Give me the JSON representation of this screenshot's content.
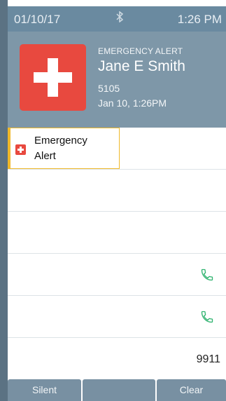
{
  "status_bar": {
    "date": "01/10/17",
    "bluetooth_symbol": "∦",
    "time": "1:26 PM"
  },
  "alert_header": {
    "type": "EMERGENCY ALERT",
    "name": "Jane E Smith",
    "extension": "5105",
    "datetime": "Jan 10, 1:26PM",
    "icon": "red-cross-icon"
  },
  "list": {
    "selected_item": {
      "label_line1": "Emergency",
      "label_line2": "Alert",
      "icon": "red-cross-icon"
    },
    "rows": [
      {
        "icon": "",
        "number": ""
      },
      {
        "icon": "",
        "number": ""
      },
      {
        "icon": "",
        "number": ""
      },
      {
        "icon": "phone-icon",
        "number": ""
      },
      {
        "icon": "phone-icon",
        "number": ""
      },
      {
        "icon": "",
        "number": "9911"
      }
    ]
  },
  "softkeys": {
    "left": "Silent",
    "middle": "",
    "right": "Clear"
  },
  "colors": {
    "status_bar": "#6a8aa0",
    "header": "#7e97a8",
    "alert_red": "#e8493f",
    "selection_border": "#f0b92a",
    "phone_green": "#2fb36f",
    "softkey": "#7890a2"
  }
}
